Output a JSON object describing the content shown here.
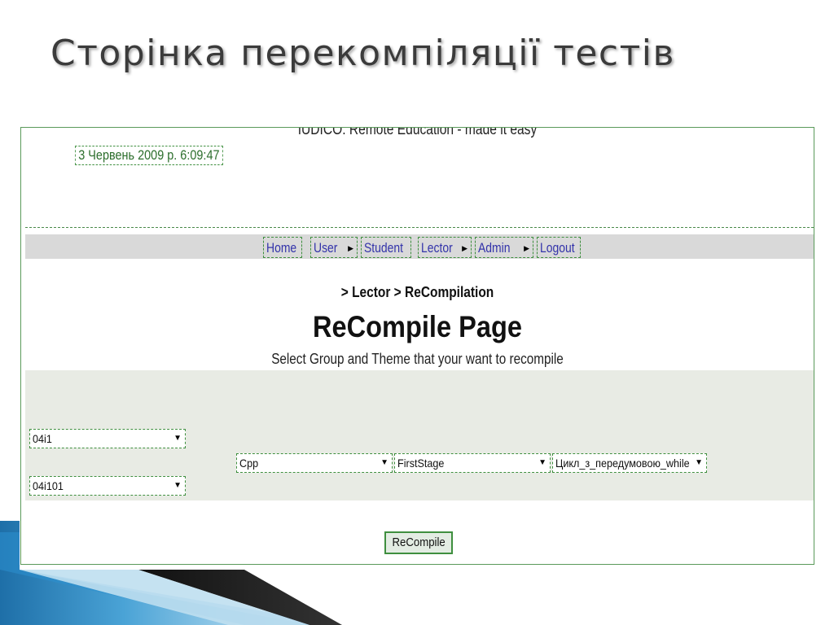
{
  "slide": {
    "title": "Сторінка перекомпіляції тестів"
  },
  "app": {
    "title": "IUDICO. Remote Education - made it easy",
    "datetime": "3 Червень 2009 р. 6:09:47"
  },
  "nav": {
    "items": [
      {
        "label": "Home",
        "submenu": false
      },
      {
        "label": "User",
        "submenu": true
      },
      {
        "label": "Student",
        "submenu": false
      },
      {
        "label": "Lector",
        "submenu": true
      },
      {
        "label": "Admin",
        "submenu": true
      },
      {
        "label": "Logout",
        "submenu": false
      }
    ]
  },
  "breadcrumb": "> Lector > ReCompilation",
  "page": {
    "heading": "ReCompile Page",
    "subtitle": "Select Group and Theme that your want to recompile"
  },
  "form": {
    "group_select": "04i1",
    "subgroup_select": "04i101",
    "course_select": "Cpp",
    "stage_select": "FirstStage",
    "theme_select": "Цикл_з_передумовою_while",
    "submit_label": "ReCompile"
  },
  "colors": {
    "border_green": "#3f8f3f",
    "nav_link": "#3333aa",
    "nav_bg": "#d9d9d9",
    "form_band_bg": "#e8ebe4"
  }
}
